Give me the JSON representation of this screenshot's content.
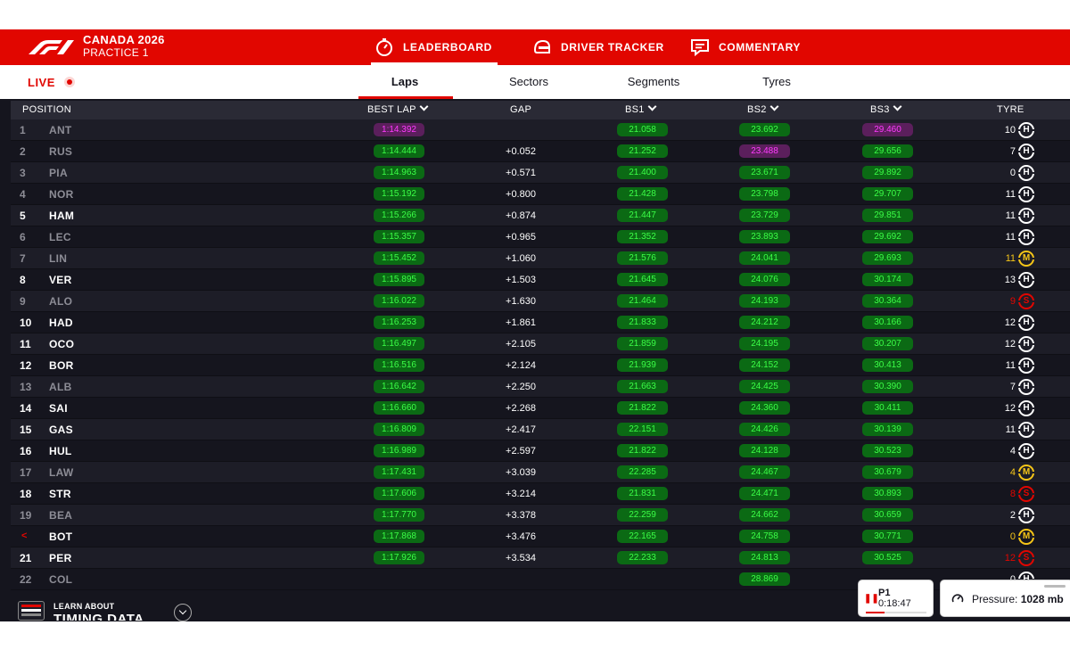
{
  "header": {
    "event_line1": "CANADA 2026",
    "event_line2": "PRACTICE 1",
    "nav": [
      {
        "label": "LEADERBOARD",
        "icon": "stopwatch-icon",
        "active": true
      },
      {
        "label": "DRIVER TRACKER",
        "icon": "helmet-icon",
        "active": false
      },
      {
        "label": "COMMENTARY",
        "icon": "commentary-icon",
        "active": false
      }
    ]
  },
  "subbar": {
    "live_label": "LIVE",
    "tabs": [
      {
        "label": "Laps",
        "active": true
      },
      {
        "label": "Sectors",
        "active": false
      },
      {
        "label": "Segments",
        "active": false
      },
      {
        "label": "Tyres",
        "active": false
      }
    ]
  },
  "table": {
    "headers": {
      "position": "POSITION",
      "best_lap": "BEST LAP",
      "gap": "GAP",
      "bs1": "BS1",
      "bs2": "BS2",
      "bs3": "BS3",
      "tyre": "TYRE"
    },
    "rows": [
      {
        "pos": "1",
        "driver": "ANT",
        "dim": true,
        "best_lap": "1:14.392",
        "best_lap_color": "purple",
        "gap": "",
        "bs1": "21.058",
        "bs1_color": "green",
        "bs2": "23.692",
        "bs2_color": "green",
        "bs3": "29.460",
        "bs3_color": "purple",
        "laps": "10",
        "laps_color": "white",
        "tyre": "H"
      },
      {
        "pos": "2",
        "driver": "RUS",
        "dim": true,
        "best_lap": "1:14.444",
        "best_lap_color": "green",
        "gap": "+0.052",
        "bs1": "21.252",
        "bs1_color": "green",
        "bs2": "23.488",
        "bs2_color": "purple",
        "bs3": "29.656",
        "bs3_color": "green",
        "laps": "7",
        "laps_color": "white",
        "tyre": "H"
      },
      {
        "pos": "3",
        "driver": "PIA",
        "dim": true,
        "best_lap": "1:14.963",
        "best_lap_color": "green",
        "gap": "+0.571",
        "bs1": "21.400",
        "bs1_color": "green",
        "bs2": "23.671",
        "bs2_color": "green",
        "bs3": "29.892",
        "bs3_color": "green",
        "laps": "0",
        "laps_color": "white",
        "tyre": "H"
      },
      {
        "pos": "4",
        "driver": "NOR",
        "dim": true,
        "best_lap": "1:15.192",
        "best_lap_color": "green",
        "gap": "+0.800",
        "bs1": "21.428",
        "bs1_color": "green",
        "bs2": "23.798",
        "bs2_color": "green",
        "bs3": "29.707",
        "bs3_color": "green",
        "laps": "11",
        "laps_color": "white",
        "tyre": "H"
      },
      {
        "pos": "5",
        "driver": "HAM",
        "dim": false,
        "best_lap": "1:15.266",
        "best_lap_color": "green",
        "gap": "+0.874",
        "bs1": "21.447",
        "bs1_color": "green",
        "bs2": "23.729",
        "bs2_color": "green",
        "bs3": "29.851",
        "bs3_color": "green",
        "laps": "11",
        "laps_color": "white",
        "tyre": "H"
      },
      {
        "pos": "6",
        "driver": "LEC",
        "dim": true,
        "best_lap": "1:15.357",
        "best_lap_color": "green",
        "gap": "+0.965",
        "bs1": "21.352",
        "bs1_color": "green",
        "bs2": "23.893",
        "bs2_color": "green",
        "bs3": "29.692",
        "bs3_color": "green",
        "laps": "11",
        "laps_color": "white",
        "tyre": "H"
      },
      {
        "pos": "7",
        "driver": "LIN",
        "dim": true,
        "best_lap": "1:15.452",
        "best_lap_color": "green",
        "gap": "+1.060",
        "bs1": "21.576",
        "bs1_color": "green",
        "bs2": "24.041",
        "bs2_color": "green",
        "bs3": "29.693",
        "bs3_color": "green",
        "laps": "11",
        "laps_color": "#f5c518",
        "tyre": "M"
      },
      {
        "pos": "8",
        "driver": "VER",
        "dim": false,
        "best_lap": "1:15.895",
        "best_lap_color": "green",
        "gap": "+1.503",
        "bs1": "21.645",
        "bs1_color": "green",
        "bs2": "24.076",
        "bs2_color": "green",
        "bs3": "30.174",
        "bs3_color": "green",
        "laps": "13",
        "laps_color": "white",
        "tyre": "H"
      },
      {
        "pos": "9",
        "driver": "ALO",
        "dim": true,
        "best_lap": "1:16.022",
        "best_lap_color": "green",
        "gap": "+1.630",
        "bs1": "21.464",
        "bs1_color": "green",
        "bs2": "24.193",
        "bs2_color": "green",
        "bs3": "30.364",
        "bs3_color": "green",
        "laps": "9",
        "laps_color": "#e10600",
        "tyre": "S"
      },
      {
        "pos": "10",
        "driver": "HAD",
        "dim": false,
        "best_lap": "1:16.253",
        "best_lap_color": "green",
        "gap": "+1.861",
        "bs1": "21.833",
        "bs1_color": "green",
        "bs2": "24.212",
        "bs2_color": "green",
        "bs3": "30.166",
        "bs3_color": "green",
        "laps": "12",
        "laps_color": "white",
        "tyre": "H"
      },
      {
        "pos": "11",
        "driver": "OCO",
        "dim": false,
        "best_lap": "1:16.497",
        "best_lap_color": "green",
        "gap": "+2.105",
        "bs1": "21.859",
        "bs1_color": "green",
        "bs2": "24.195",
        "bs2_color": "green",
        "bs3": "30.207",
        "bs3_color": "green",
        "laps": "12",
        "laps_color": "white",
        "tyre": "H"
      },
      {
        "pos": "12",
        "driver": "BOR",
        "dim": false,
        "best_lap": "1:16.516",
        "best_lap_color": "green",
        "gap": "+2.124",
        "bs1": "21.939",
        "bs1_color": "green",
        "bs2": "24.152",
        "bs2_color": "green",
        "bs3": "30.413",
        "bs3_color": "green",
        "laps": "11",
        "laps_color": "white",
        "tyre": "H"
      },
      {
        "pos": "13",
        "driver": "ALB",
        "dim": true,
        "best_lap": "1:16.642",
        "best_lap_color": "green",
        "gap": "+2.250",
        "bs1": "21.663",
        "bs1_color": "green",
        "bs2": "24.425",
        "bs2_color": "green",
        "bs3": "30.390",
        "bs3_color": "green",
        "laps": "7",
        "laps_color": "white",
        "tyre": "H"
      },
      {
        "pos": "14",
        "driver": "SAI",
        "dim": false,
        "best_lap": "1:16.660",
        "best_lap_color": "green",
        "gap": "+2.268",
        "bs1": "21.822",
        "bs1_color": "green",
        "bs2": "24.360",
        "bs2_color": "green",
        "bs3": "30.411",
        "bs3_color": "green",
        "laps": "12",
        "laps_color": "white",
        "tyre": "H"
      },
      {
        "pos": "15",
        "driver": "GAS",
        "dim": false,
        "best_lap": "1:16.809",
        "best_lap_color": "green",
        "gap": "+2.417",
        "bs1": "22.151",
        "bs1_color": "green",
        "bs2": "24.426",
        "bs2_color": "green",
        "bs3": "30.139",
        "bs3_color": "green",
        "laps": "11",
        "laps_color": "white",
        "tyre": "H"
      },
      {
        "pos": "16",
        "driver": "HUL",
        "dim": false,
        "best_lap": "1:16.989",
        "best_lap_color": "green",
        "gap": "+2.597",
        "bs1": "21.822",
        "bs1_color": "green",
        "bs2": "24.128",
        "bs2_color": "green",
        "bs3": "30.523",
        "bs3_color": "green",
        "laps": "4",
        "laps_color": "white",
        "tyre": "H"
      },
      {
        "pos": "17",
        "driver": "LAW",
        "dim": true,
        "best_lap": "1:17.431",
        "best_lap_color": "green",
        "gap": "+3.039",
        "bs1": "22.285",
        "bs1_color": "green",
        "bs2": "24.467",
        "bs2_color": "green",
        "bs3": "30.679",
        "bs3_color": "green",
        "laps": "4",
        "laps_color": "#f5c518",
        "tyre": "M"
      },
      {
        "pos": "18",
        "driver": "STR",
        "dim": false,
        "best_lap": "1:17.606",
        "best_lap_color": "green",
        "gap": "+3.214",
        "bs1": "21.831",
        "bs1_color": "green",
        "bs2": "24.471",
        "bs2_color": "green",
        "bs3": "30.893",
        "bs3_color": "green",
        "laps": "8",
        "laps_color": "#e10600",
        "tyre": "S"
      },
      {
        "pos": "19",
        "driver": "BEA",
        "dim": true,
        "best_lap": "1:17.770",
        "best_lap_color": "green",
        "gap": "+3.378",
        "bs1": "22.259",
        "bs1_color": "green",
        "bs2": "24.662",
        "bs2_color": "green",
        "bs3": "30.659",
        "bs3_color": "green",
        "laps": "2",
        "laps_color": "white",
        "tyre": "H"
      },
      {
        "pos": "<",
        "driver": "BOT",
        "dim": false,
        "pos_arrow": true,
        "best_lap": "1:17.868",
        "best_lap_color": "green",
        "gap": "+3.476",
        "bs1": "22.165",
        "bs1_color": "green",
        "bs2": "24.758",
        "bs2_color": "green",
        "bs3": "30.771",
        "bs3_color": "green",
        "laps": "0",
        "laps_color": "#f5c518",
        "tyre": "M"
      },
      {
        "pos": "21",
        "driver": "PER",
        "dim": false,
        "best_lap": "1:17.926",
        "best_lap_color": "green",
        "gap": "+3.534",
        "bs1": "22.233",
        "bs1_color": "green",
        "bs2": "24.813",
        "bs2_color": "green",
        "bs3": "30.525",
        "bs3_color": "green",
        "laps": "12",
        "laps_color": "#e10600",
        "tyre": "S"
      },
      {
        "pos": "22",
        "driver": "COL",
        "dim": true,
        "best_lap": "",
        "best_lap_color": "green",
        "gap": "",
        "bs1": "",
        "bs1_color": "green",
        "bs2": "28.869",
        "bs2_color": "green",
        "bs3": "",
        "bs3_color": "green",
        "laps": "0",
        "laps_color": "white",
        "tyre": "H"
      }
    ]
  },
  "footer": {
    "learn_line1": "LEARN ABOUT",
    "learn_line2": "TIMING DATA",
    "session_label": "P1",
    "session_time": "0:18:47",
    "session_progress": 0.31,
    "pressure_label": "Pressure:",
    "pressure_value": "1028 mb"
  },
  "colors": {
    "brand_red": "#e10600",
    "green_chip_text": "#3bff47",
    "purple_chip_text": "#ff3bff",
    "background": "#15151e"
  }
}
